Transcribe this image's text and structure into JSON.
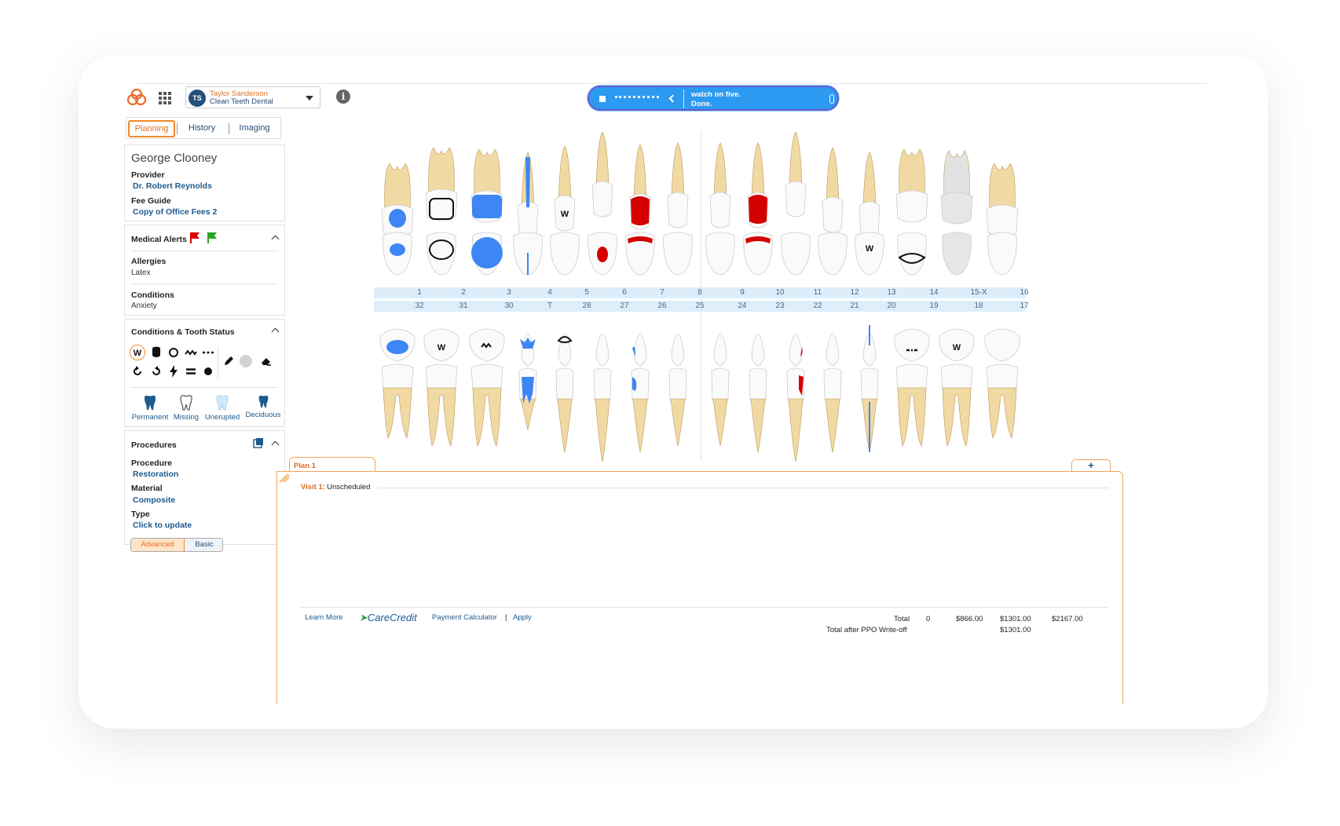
{
  "header": {
    "user_initials": "TS",
    "user_name": "Taylor Sanderson",
    "clinic": "Clean Teeth Dental"
  },
  "tabs": {
    "planning": "Planning",
    "history": "History",
    "imaging": "Imaging"
  },
  "patient": {
    "name": "George Clooney",
    "provider_label": "Provider",
    "provider": "Dr. Robert Reynolds",
    "fee_label": "Fee Guide",
    "fee_guide": "Copy of Office Fees 2"
  },
  "medical": {
    "title": "Medical Alerts",
    "allergies_label": "Allergies",
    "allergies": "Latex",
    "conditions_label": "Conditions",
    "conditions": "Anxiety"
  },
  "conditions_panel": {
    "title": "Conditions & Tooth Status",
    "tooth_types": [
      "Permanent",
      "Missing",
      "Unerupted",
      "Deciduous"
    ]
  },
  "procedures": {
    "title": "Procedures",
    "procedure_label": "Procedure",
    "procedure": "Restoration",
    "material_label": "Material",
    "material": "Composite",
    "type_label": "Type",
    "type": "Click to update",
    "mode_advanced": "Advanced",
    "mode_basic": "Basic"
  },
  "recording": {
    "line1": "watch on five.",
    "line2": "Done."
  },
  "chart": {
    "upper_numbers": [
      "1",
      "2",
      "3",
      "4",
      "5",
      "6",
      "7",
      "8",
      "9",
      "10",
      "11",
      "12",
      "13",
      "14",
      "15-X",
      "16"
    ],
    "lower_numbers": [
      "32",
      "31",
      "30",
      "T",
      "28",
      "27",
      "26",
      "25",
      "24",
      "23",
      "22",
      "21",
      "20",
      "19",
      "18",
      "17"
    ]
  },
  "plan": {
    "tab": "Plan 1",
    "add": "+",
    "visit_label": "Visit 1",
    "visit_status": ": Unscheduled",
    "learn_more": "Learn More",
    "carecredit": "CareCredit",
    "payment_calc": "Payment Calculator",
    "sep": "|",
    "apply": "Apply",
    "total_label": "Total",
    "total_count": "0",
    "total_1": "$866.00",
    "total_2": "$1301.00",
    "total_3": "$2167.00",
    "after_ppo_label": "Total after PPO Write-off",
    "after_ppo": "$1301.00"
  },
  "colors": {
    "accent": "#f08a2a",
    "link": "#1d5a8e",
    "blue_fill": "#3d86f3",
    "red_fill": "#d40000",
    "tooth": "#f1d9a4"
  }
}
